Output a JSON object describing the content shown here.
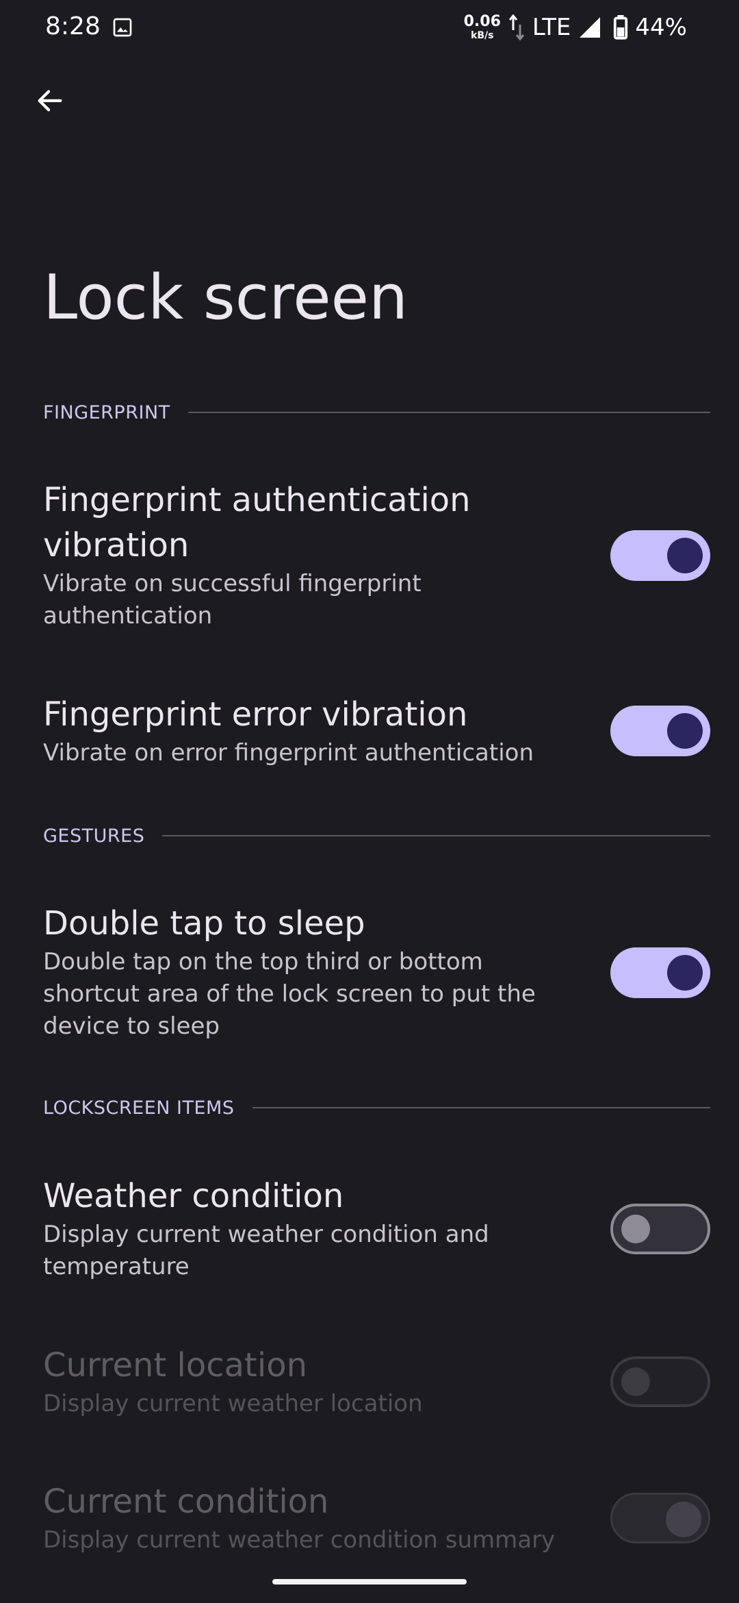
{
  "status_bar": {
    "time": "8:28",
    "net_speed_value": "0.06",
    "net_speed_unit": "kB/s",
    "network": "LTE",
    "battery": "44%"
  },
  "page": {
    "title": "Lock screen"
  },
  "sections": {
    "fingerprint": {
      "header": "FINGERPRINT",
      "items": [
        {
          "title": "Fingerprint authentication vibration",
          "summary": "Vibrate on successful fingerprint authentication",
          "toggle": "on"
        },
        {
          "title": "Fingerprint error vibration",
          "summary": "Vibrate on error fingerprint authentication",
          "toggle": "on"
        }
      ]
    },
    "gestures": {
      "header": "GESTURES",
      "items": [
        {
          "title": "Double tap to sleep",
          "summary": "Double tap on the top third or bottom shortcut area of the lock screen to put the device to sleep",
          "toggle": "on"
        }
      ]
    },
    "lockscreen_items": {
      "header": "LOCKSCREEN ITEMS",
      "items": [
        {
          "title": "Weather condition",
          "summary": "Display current weather condition and temperature",
          "toggle": "off",
          "enabled": true
        },
        {
          "title": "Current location",
          "summary": "Display current weather location",
          "toggle": "off",
          "enabled": false
        },
        {
          "title": "Current condition",
          "summary": "Display current weather condition summary",
          "toggle": "on",
          "enabled": false
        }
      ]
    }
  },
  "colors": {
    "background": "#1c1b20",
    "accent": "#c6beff",
    "section_header": "#cfc7ef"
  },
  "icons": {
    "back": "arrow-back-icon",
    "gallery": "image-icon",
    "signal": "cell-signal-icon",
    "battery": "battery-icon"
  }
}
